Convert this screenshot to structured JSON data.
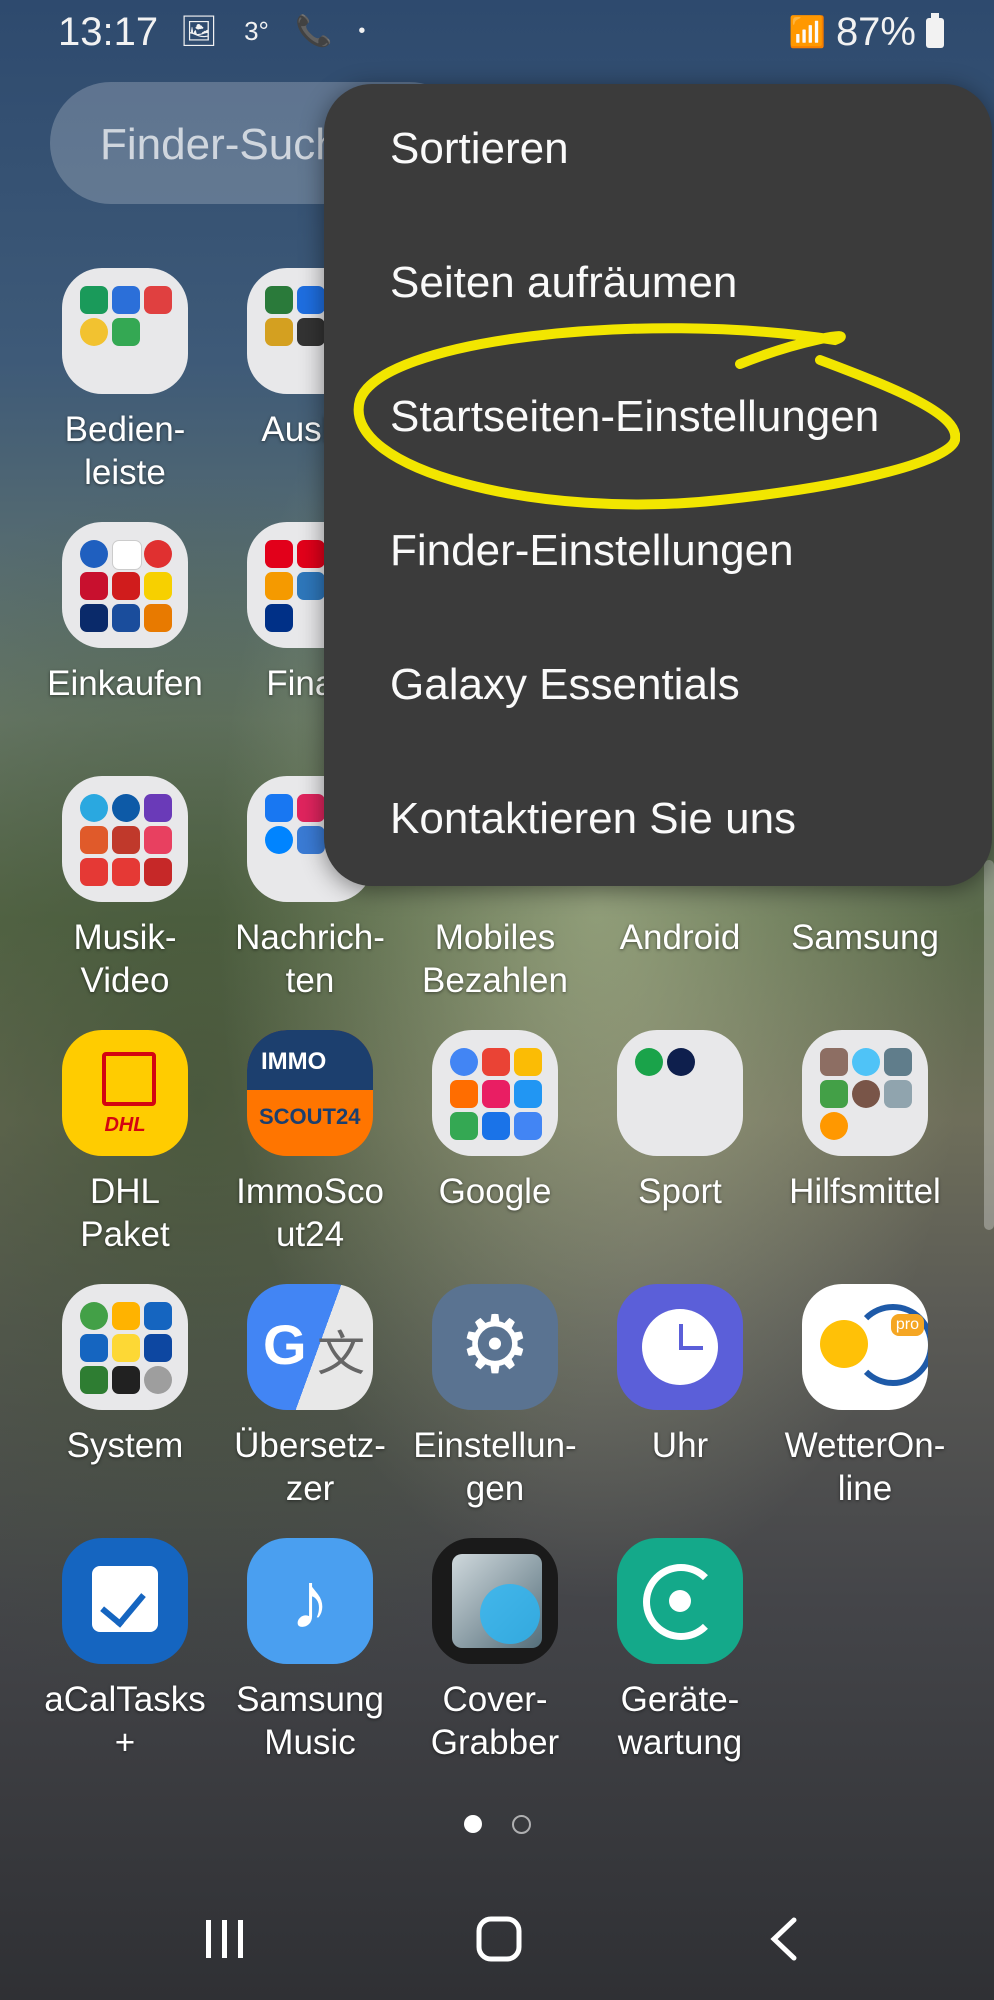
{
  "status": {
    "time": "13:17",
    "temperature": "3°",
    "battery": "87%"
  },
  "search": {
    "placeholder": "Finder-Such"
  },
  "menu": {
    "items": [
      "Sortieren",
      "Seiten aufräumen",
      "Startseiten-Einstellungen",
      "Finder-Einstellungen",
      "Galaxy Essentials",
      "Kontaktieren Sie uns"
    ],
    "highlighted": "Startseiten-Einstellungen",
    "highlight_color": "#f2e600"
  },
  "apps": {
    "row1": [
      "Bedien-\nleiste",
      "Auskü"
    ],
    "row2": [
      "Einkaufen",
      "Finan"
    ],
    "row3": [
      "Musik-\nVideo",
      "Nachrich-\nten",
      "Mobiles\nBezahlen",
      "Android",
      "Samsung"
    ],
    "row4": [
      "DHL\nPaket",
      "ImmoSco\nut24",
      "Google",
      "Sport",
      "Hilfsmittel"
    ],
    "row5": [
      "System",
      "Übersetz-\nzer",
      "Einstellun-\ngen",
      "Uhr",
      "WetterOn-\nline"
    ],
    "row6": [
      "aCalTasks\n+",
      "Samsung\nMusic",
      "Cover-\nGrabber",
      "Geräte-\nwartung"
    ]
  },
  "icon_text": {
    "dhl": "DHL",
    "immo_top": "IMMO",
    "immo_bottom": "SCOUT24",
    "wetter_badge": "pro"
  },
  "page_indicator": {
    "pages": 2,
    "current": 1
  }
}
